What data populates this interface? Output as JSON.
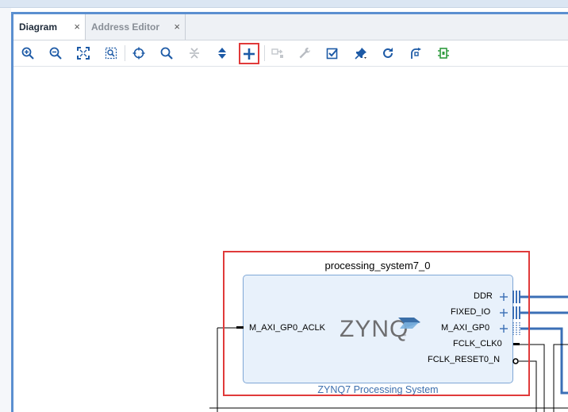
{
  "tabs": [
    {
      "label": "Diagram",
      "close": "×",
      "active": true
    },
    {
      "label": "Address Editor",
      "close": "×",
      "active": false
    }
  ],
  "toolbar": [
    {
      "name": "zoom-in-icon",
      "enabled": true
    },
    {
      "name": "zoom-out-icon",
      "enabled": true
    },
    {
      "name": "zoom-fit-icon",
      "enabled": true
    },
    {
      "name": "zoom-area-icon",
      "enabled": true
    },
    {
      "name": "auto-fit-selection-icon",
      "enabled": true
    },
    {
      "name": "search-icon",
      "enabled": true
    },
    {
      "name": "collapse-all-icon",
      "enabled": false
    },
    {
      "name": "expand-all-icon",
      "enabled": true
    },
    {
      "name": "add-ip-icon",
      "enabled": true,
      "selected": true
    },
    {
      "name": "make-connection-icon",
      "enabled": false
    },
    {
      "name": "properties-wrench-icon",
      "enabled": false
    },
    {
      "name": "validate-design-icon",
      "enabled": true
    },
    {
      "name": "pin-icon",
      "enabled": true
    },
    {
      "name": "regenerate-layout-icon",
      "enabled": true
    },
    {
      "name": "optimize-routing-icon",
      "enabled": true
    },
    {
      "name": "run-connection-automation-icon",
      "enabled": true
    }
  ],
  "block": {
    "instance_name": "processing_system7_0",
    "display_name": "ZYNQ7 Processing System",
    "logo_text": "ZYNQ",
    "input_ports": [
      "M_AXI_GP0_ACLK"
    ],
    "output_ports": [
      "DDR",
      "FIXED_IO",
      "M_AXI_GP0",
      "FCLK_CLK0",
      "FCLK_RESET0_N"
    ]
  },
  "colors": {
    "accent_border": "#5b8fd0",
    "highlight": "#e03a3a",
    "block_fill": "#e8f1fb",
    "bus_line": "#3b6fb6"
  }
}
